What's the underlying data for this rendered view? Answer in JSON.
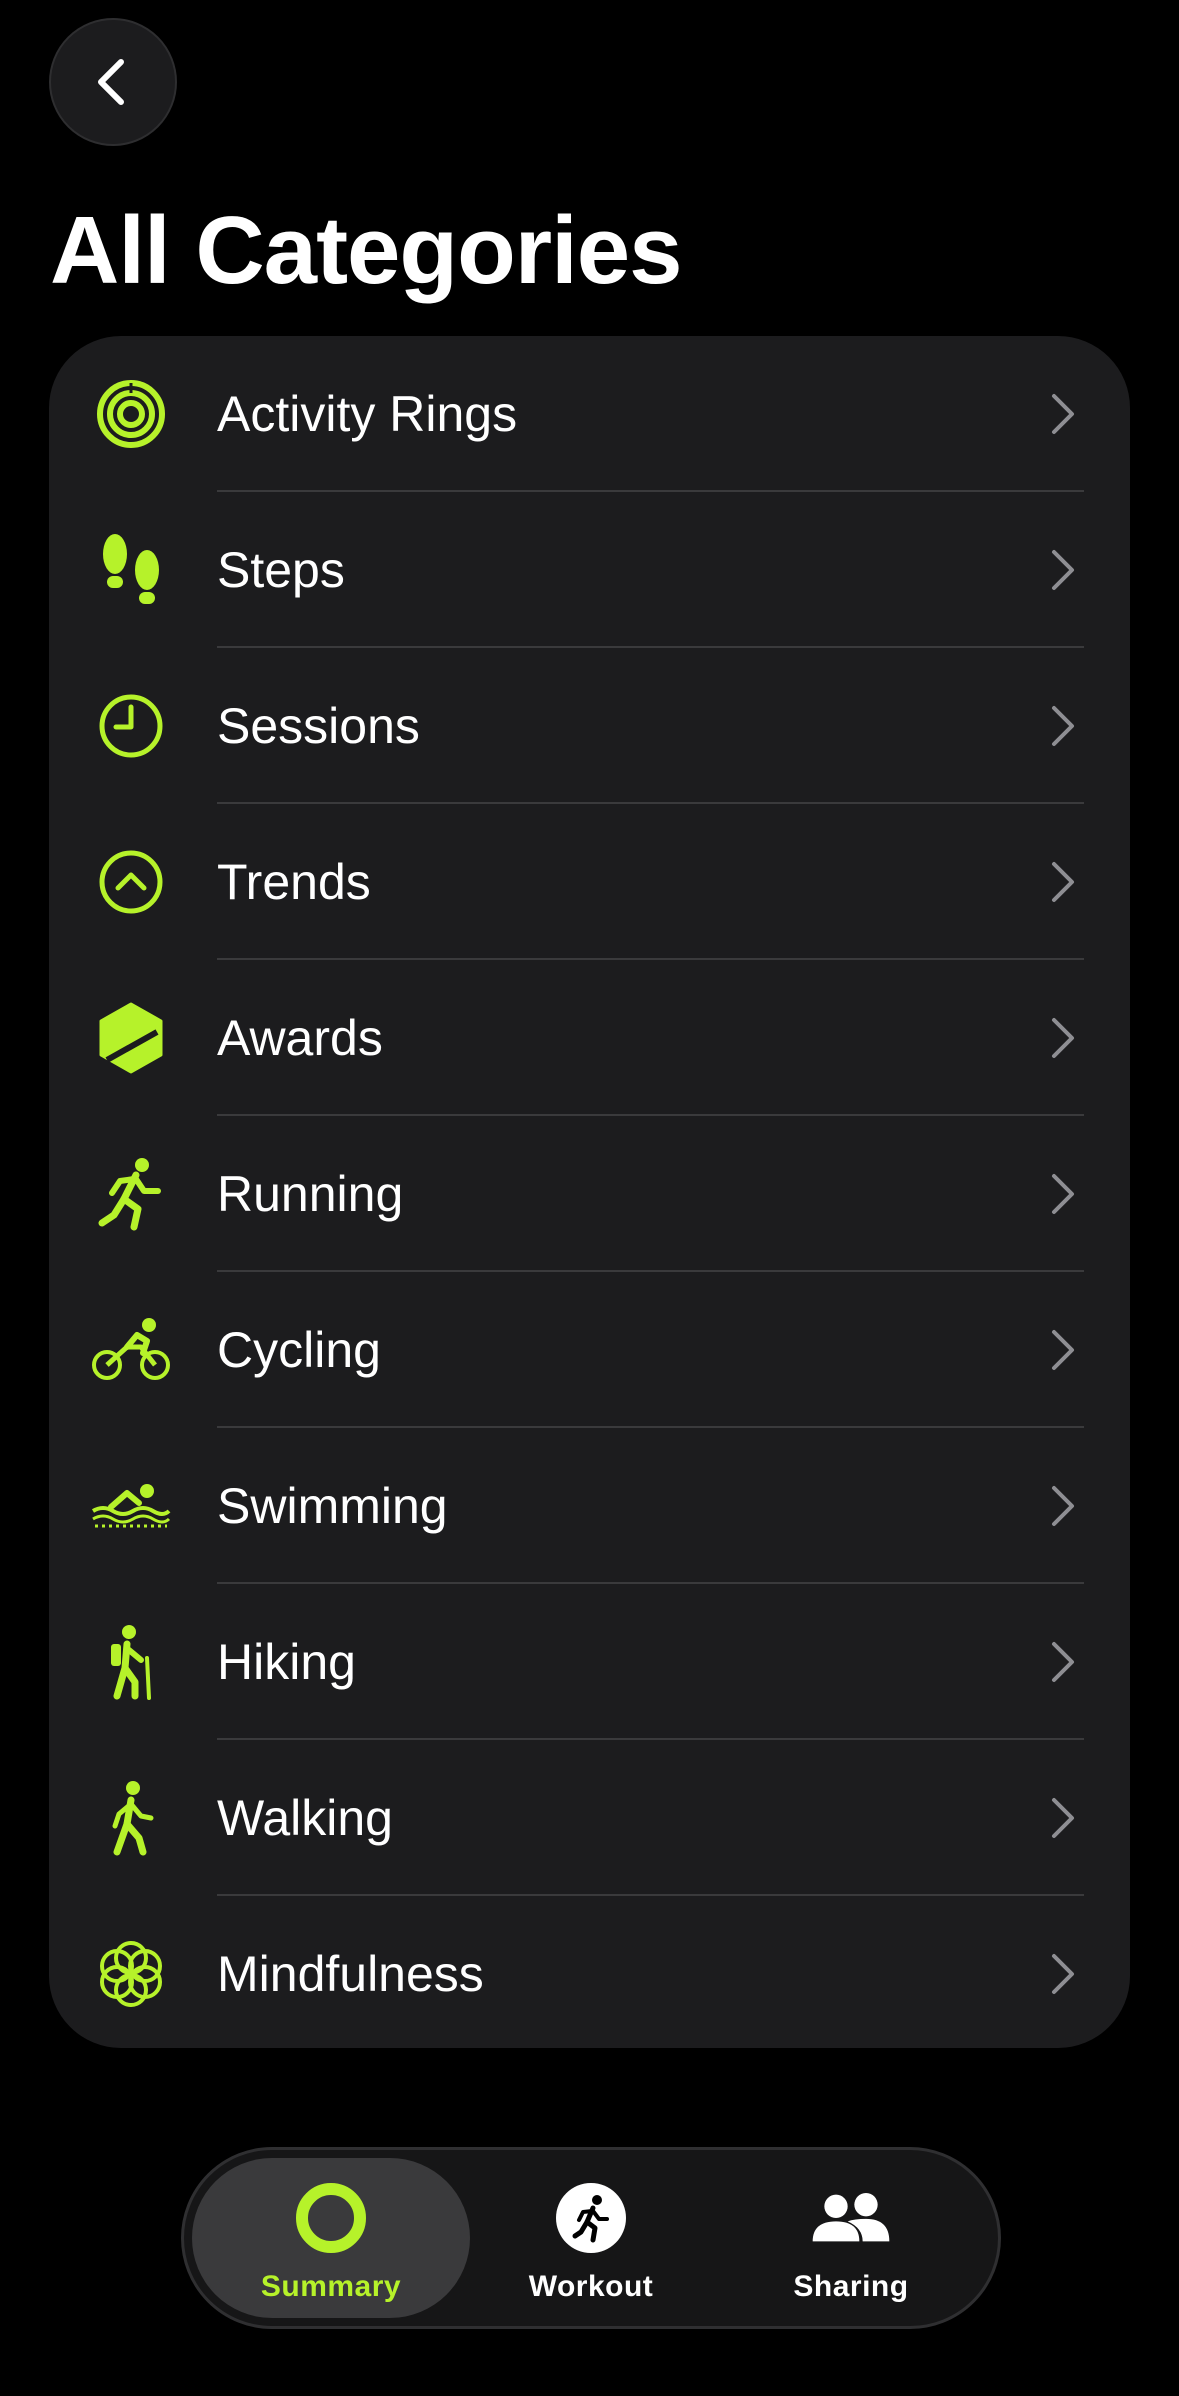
{
  "header": {
    "title": "All Categories"
  },
  "colors": {
    "accent": "#b6f22a",
    "card": "#1c1c1e",
    "background": "#000000",
    "chevron": "#8e8e93"
  },
  "categories": [
    {
      "label": "Activity Rings",
      "icon": "activity-rings-icon"
    },
    {
      "label": "Steps",
      "icon": "footprints-icon"
    },
    {
      "label": "Sessions",
      "icon": "clock-icon"
    },
    {
      "label": "Trends",
      "icon": "trend-up-icon"
    },
    {
      "label": "Awards",
      "icon": "award-badge-icon"
    },
    {
      "label": "Running",
      "icon": "runner-icon"
    },
    {
      "label": "Cycling",
      "icon": "cyclist-icon"
    },
    {
      "label": "Swimming",
      "icon": "swimmer-icon"
    },
    {
      "label": "Hiking",
      "icon": "hiker-icon"
    },
    {
      "label": "Walking",
      "icon": "walker-icon"
    },
    {
      "label": "Mindfulness",
      "icon": "flower-icon"
    }
  ],
  "tabbar": {
    "tabs": [
      {
        "label": "Summary",
        "icon": "summary-ring-icon",
        "active": true
      },
      {
        "label": "Workout",
        "icon": "workout-runner-icon",
        "active": false
      },
      {
        "label": "Sharing",
        "icon": "people-icon",
        "active": false
      }
    ]
  }
}
